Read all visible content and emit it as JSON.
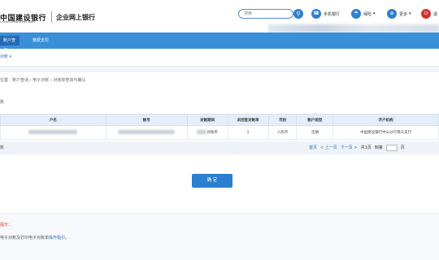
{
  "header": {
    "logo_cn": "中国建设银行",
    "logo_en": "China Construction Bank",
    "product": "企业网上银行",
    "search_placeholder": "搜索",
    "links": [
      {
        "label": "手机银行",
        "icon": "phone-icon"
      },
      {
        "label": "保险",
        "icon": "umbrella-icon"
      },
      {
        "label": "更多",
        "icon": "more-icon"
      },
      {
        "label": "退",
        "icon": "logout-icon"
      }
    ]
  },
  "nav": {
    "tabs": [
      {
        "label": "账户查询",
        "active": true
      },
      {
        "label": "缴费支付",
        "active": false
      }
    ]
  },
  "subnav": {
    "label": "对账 ▾"
  },
  "breadcrumb": "位置：账户查询 › 电子对账 › 对账单查询与确认",
  "section_label": "账",
  "table": {
    "headers": [
      "户名",
      "账号",
      "对账期间",
      "未回签对账单",
      "币别",
      "账户类型",
      "开户机构"
    ],
    "rows": [
      [
        "",
        "",
        "对账单",
        "1",
        "人民币",
        "活期",
        "中国建设银行中山分行南头支行"
      ]
    ]
  },
  "pager": {
    "left": "账",
    "first": "首页",
    "prev": "< 上一页",
    "next": "下一页 >",
    "total": "共1页",
    "goto": "到第",
    "page_suffix": "页"
  },
  "confirm_label": "确 定",
  "tips": {
    "title": "提示：",
    "text_prefix": "电子对账及打印电子对账单",
    "link": "操作指引",
    "text_suffix": "。"
  },
  "colors": {
    "nav_blue": "#3a8fd9",
    "nav_active": "#2369b4",
    "button_blue": "#2a7fcf",
    "tip_red": "#e03a2f"
  }
}
